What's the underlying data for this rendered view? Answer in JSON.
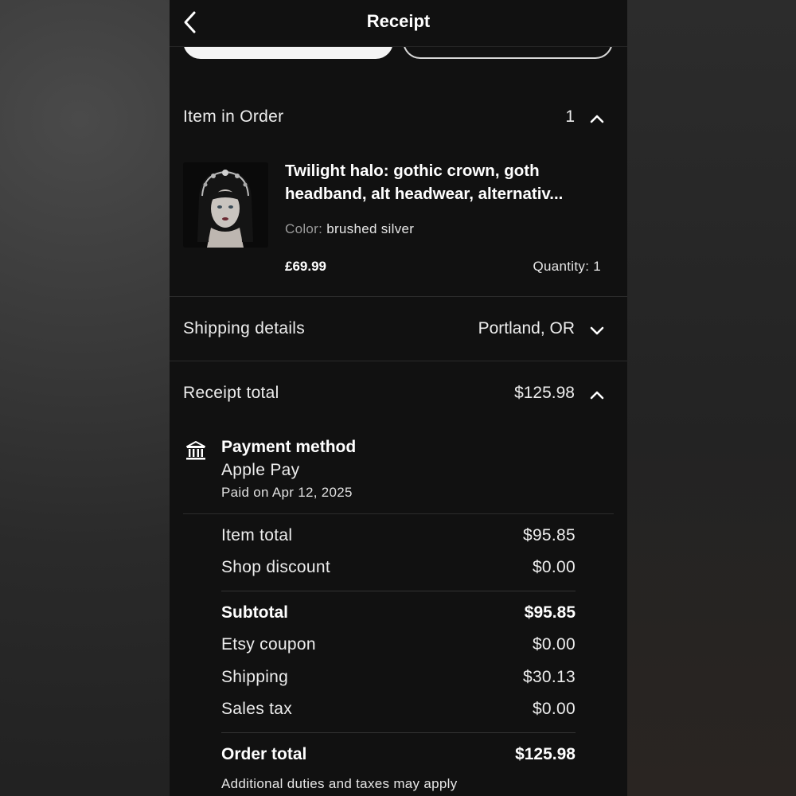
{
  "header": {
    "title": "Receipt",
    "back_icon": "chevron-left-icon"
  },
  "order_items": {
    "label": "Item in Order",
    "count": "1",
    "item": {
      "title_line1": "Twilight halo: gothic crown, goth",
      "title_line2": "headband, alt headwear, alternativ...",
      "variant_label": "Color:",
      "variant_value": "brushed silver",
      "price": "£69.99",
      "quantity": "Quantity: 1"
    }
  },
  "shipping": {
    "label": "Shipping details",
    "value": "Portland, OR"
  },
  "receipt_total": {
    "label": "Receipt total",
    "value": "$125.98"
  },
  "payment": {
    "icon": "bank-icon",
    "title": "Payment method",
    "method": "Apple Pay",
    "paid_on": "Paid on Apr 12, 2025"
  },
  "summary": {
    "item_total": {
      "label": "Item total",
      "value": "$95.85"
    },
    "shop_discount": {
      "label": "Shop discount",
      "value": "$0.00"
    },
    "subtotal": {
      "label": "Subtotal",
      "value": "$95.85"
    },
    "etsy_coupon": {
      "label": "Etsy coupon",
      "value": "$0.00"
    },
    "shipping": {
      "label": "Shipping",
      "value": "$30.13"
    },
    "sales_tax": {
      "label": "Sales tax",
      "value": "$0.00"
    },
    "order_total": {
      "label": "Order total",
      "value": "$125.98"
    },
    "footnote": "Additional duties and taxes may apply"
  }
}
